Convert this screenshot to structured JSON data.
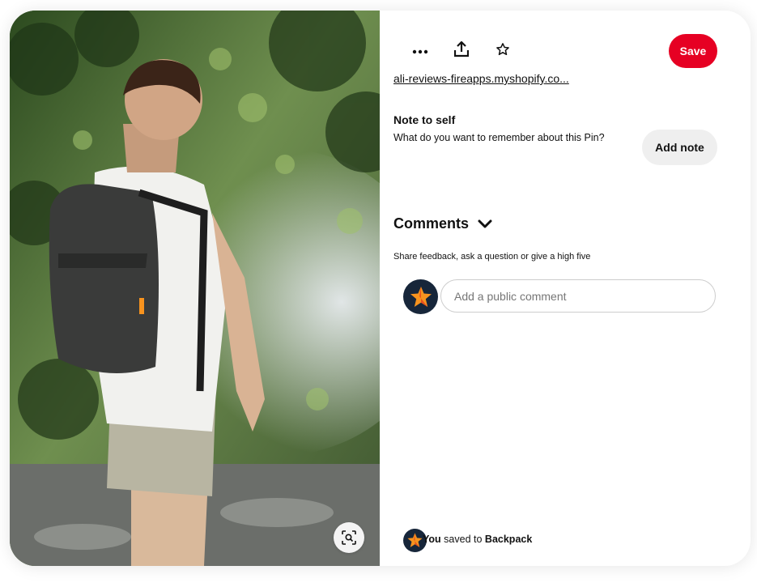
{
  "toolbar": {
    "more_icon": "ellipsis-icon",
    "share_icon": "share-upload-icon",
    "favorite_icon": "star-icon",
    "save_label": "Save"
  },
  "pin": {
    "link_text": "ali-reviews-fireapps.myshopify.co...",
    "visual_search_icon": "magnify-lens-icon"
  },
  "note": {
    "title": "Note to self",
    "prompt": "What do you want to remember about this Pin?",
    "button_label": "Add note"
  },
  "comments": {
    "title": "Comments",
    "hint": "Share feedback, ask a question or give a high five",
    "input_placeholder": "Add a public comment"
  },
  "saved": {
    "user": "You",
    "middle": "saved to",
    "board": "Backpack"
  },
  "colors": {
    "save_button": "#e60023",
    "add_note_button": "#efefef",
    "avatar_bg": "#17263a",
    "avatar_star": "#f7931e"
  }
}
